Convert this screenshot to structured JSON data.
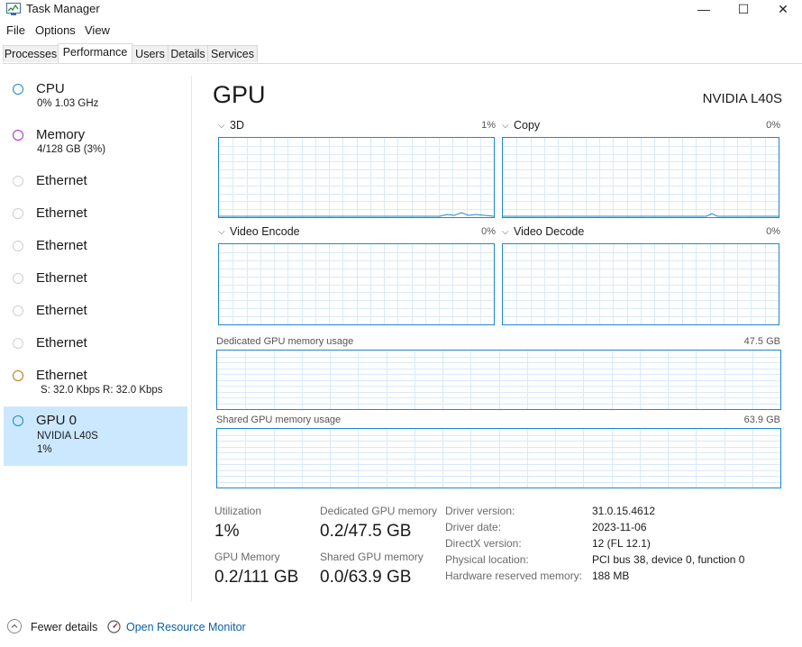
{
  "window": {
    "title": "Task Manager",
    "minimize_glyph": "—",
    "maximize_glyph": "☐",
    "close_glyph": "✕"
  },
  "menu": {
    "file": "File",
    "options": "Options",
    "view": "View"
  },
  "tabs": {
    "processes": "Processes",
    "performance": "Performance",
    "users": "Users",
    "details": "Details",
    "services": "Services",
    "active": "Performance"
  },
  "sidebar": {
    "items": [
      {
        "name": "CPU",
        "sub": "0%  1.03 GHz",
        "color": "#1e89c8"
      },
      {
        "name": "Memory",
        "sub": "4/128 GB (3%)",
        "color": "#a531b6"
      },
      {
        "name": "Ethernet",
        "sub": "",
        "color": "#cfcfcf"
      },
      {
        "name": "Ethernet",
        "sub": "",
        "color": "#cfcfcf"
      },
      {
        "name": "Ethernet",
        "sub": "",
        "color": "#cfcfcf"
      },
      {
        "name": "Ethernet",
        "sub": "",
        "color": "#cfcfcf"
      },
      {
        "name": "Ethernet",
        "sub": "",
        "color": "#cfcfcf"
      },
      {
        "name": "Ethernet",
        "sub": "",
        "color": "#cfcfcf"
      },
      {
        "name": "Ethernet",
        "sub": "S: 32.0 Kbps  R: 32.0 Kbps",
        "color": "#b8741c"
      },
      {
        "name": "GPU 0",
        "sub": "NVIDIA L40S",
        "sub2": "1%",
        "color": "#1e89c8",
        "selected": true
      }
    ]
  },
  "main": {
    "title": "GPU",
    "model": "NVIDIA L40S",
    "graphs": {
      "3d": {
        "label": "3D",
        "pct": "1%"
      },
      "copy": {
        "label": "Copy",
        "pct": "0%"
      },
      "video_encode": {
        "label": "Video Encode",
        "pct": "0%"
      },
      "video_decode": {
        "label": "Video Decode",
        "pct": "0%"
      }
    },
    "dedicated_memory": {
      "label": "Dedicated GPU memory usage",
      "max": "47.5 GB"
    },
    "shared_memory": {
      "label": "Shared GPU memory usage",
      "max": "63.9 GB"
    },
    "stats": {
      "utilization_label": "Utilization",
      "utilization_value": "1%",
      "dedicated_label": "Dedicated GPU memory",
      "dedicated_value": "0.2/47.5 GB",
      "gpu_memory_label": "GPU Memory",
      "gpu_memory_value": "0.2/111 GB",
      "shared_label": "Shared GPU memory",
      "shared_value": "0.0/63.9 GB"
    },
    "info": {
      "driver_version_label": "Driver version:",
      "driver_version": "31.0.15.4612",
      "driver_date_label": "Driver date:",
      "driver_date": "2023-11-06",
      "directx_label": "DirectX version:",
      "directx": "12 (FL 12.1)",
      "physical_location_label": "Physical location:",
      "physical_location": "PCI bus 38, device 0, function 0",
      "hw_reserved_label": "Hardware reserved memory:",
      "hw_reserved": "188 MB"
    }
  },
  "footer": {
    "fewer_details": "Fewer details",
    "open_resource_monitor": "Open Resource Monitor"
  },
  "colors": {
    "graph_border": "#1e89c8",
    "grid_line": "#d9eaf7",
    "selected_bg": "#cce8ff",
    "link": "#0b5ea8"
  }
}
